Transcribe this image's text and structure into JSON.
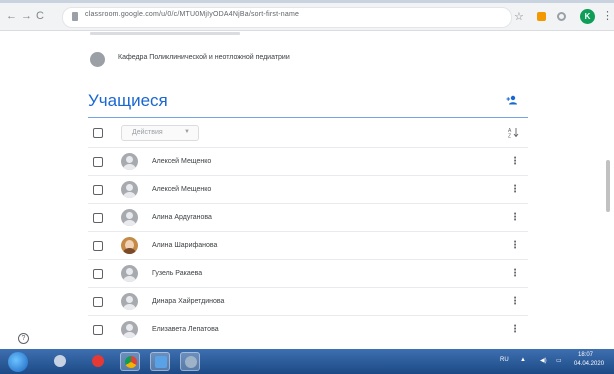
{
  "browser": {
    "back": "←",
    "forward": "→",
    "reload": "C",
    "url": "classroom.google.com/u/0/c/MTU0MjIyODA4NjBa/sort-first-name",
    "profile_initial": "K"
  },
  "teacher": {
    "name": "Кафедра Поликлинической и неотложной педиатрии"
  },
  "students_section": {
    "title": "Учащиеся",
    "actions_label": "Действия",
    "add_icon": "person-add-icon",
    "sort_icon": "sort-az-icon"
  },
  "students": [
    {
      "name": "Алексей Мещенко",
      "avatar": "default"
    },
    {
      "name": "Алексей Мещенко",
      "avatar": "default"
    },
    {
      "name": "Алина Ардуганова",
      "avatar": "default"
    },
    {
      "name": "Алина Шарифанова",
      "avatar": "photo"
    },
    {
      "name": "Гузель Ракаева",
      "avatar": "default"
    },
    {
      "name": "Динара Хайретдинова",
      "avatar": "default"
    },
    {
      "name": "Елизавета Лепатова",
      "avatar": "default"
    }
  ],
  "taskbar": {
    "lang": "RU",
    "time": "18:07",
    "date": "04.04.2020"
  }
}
